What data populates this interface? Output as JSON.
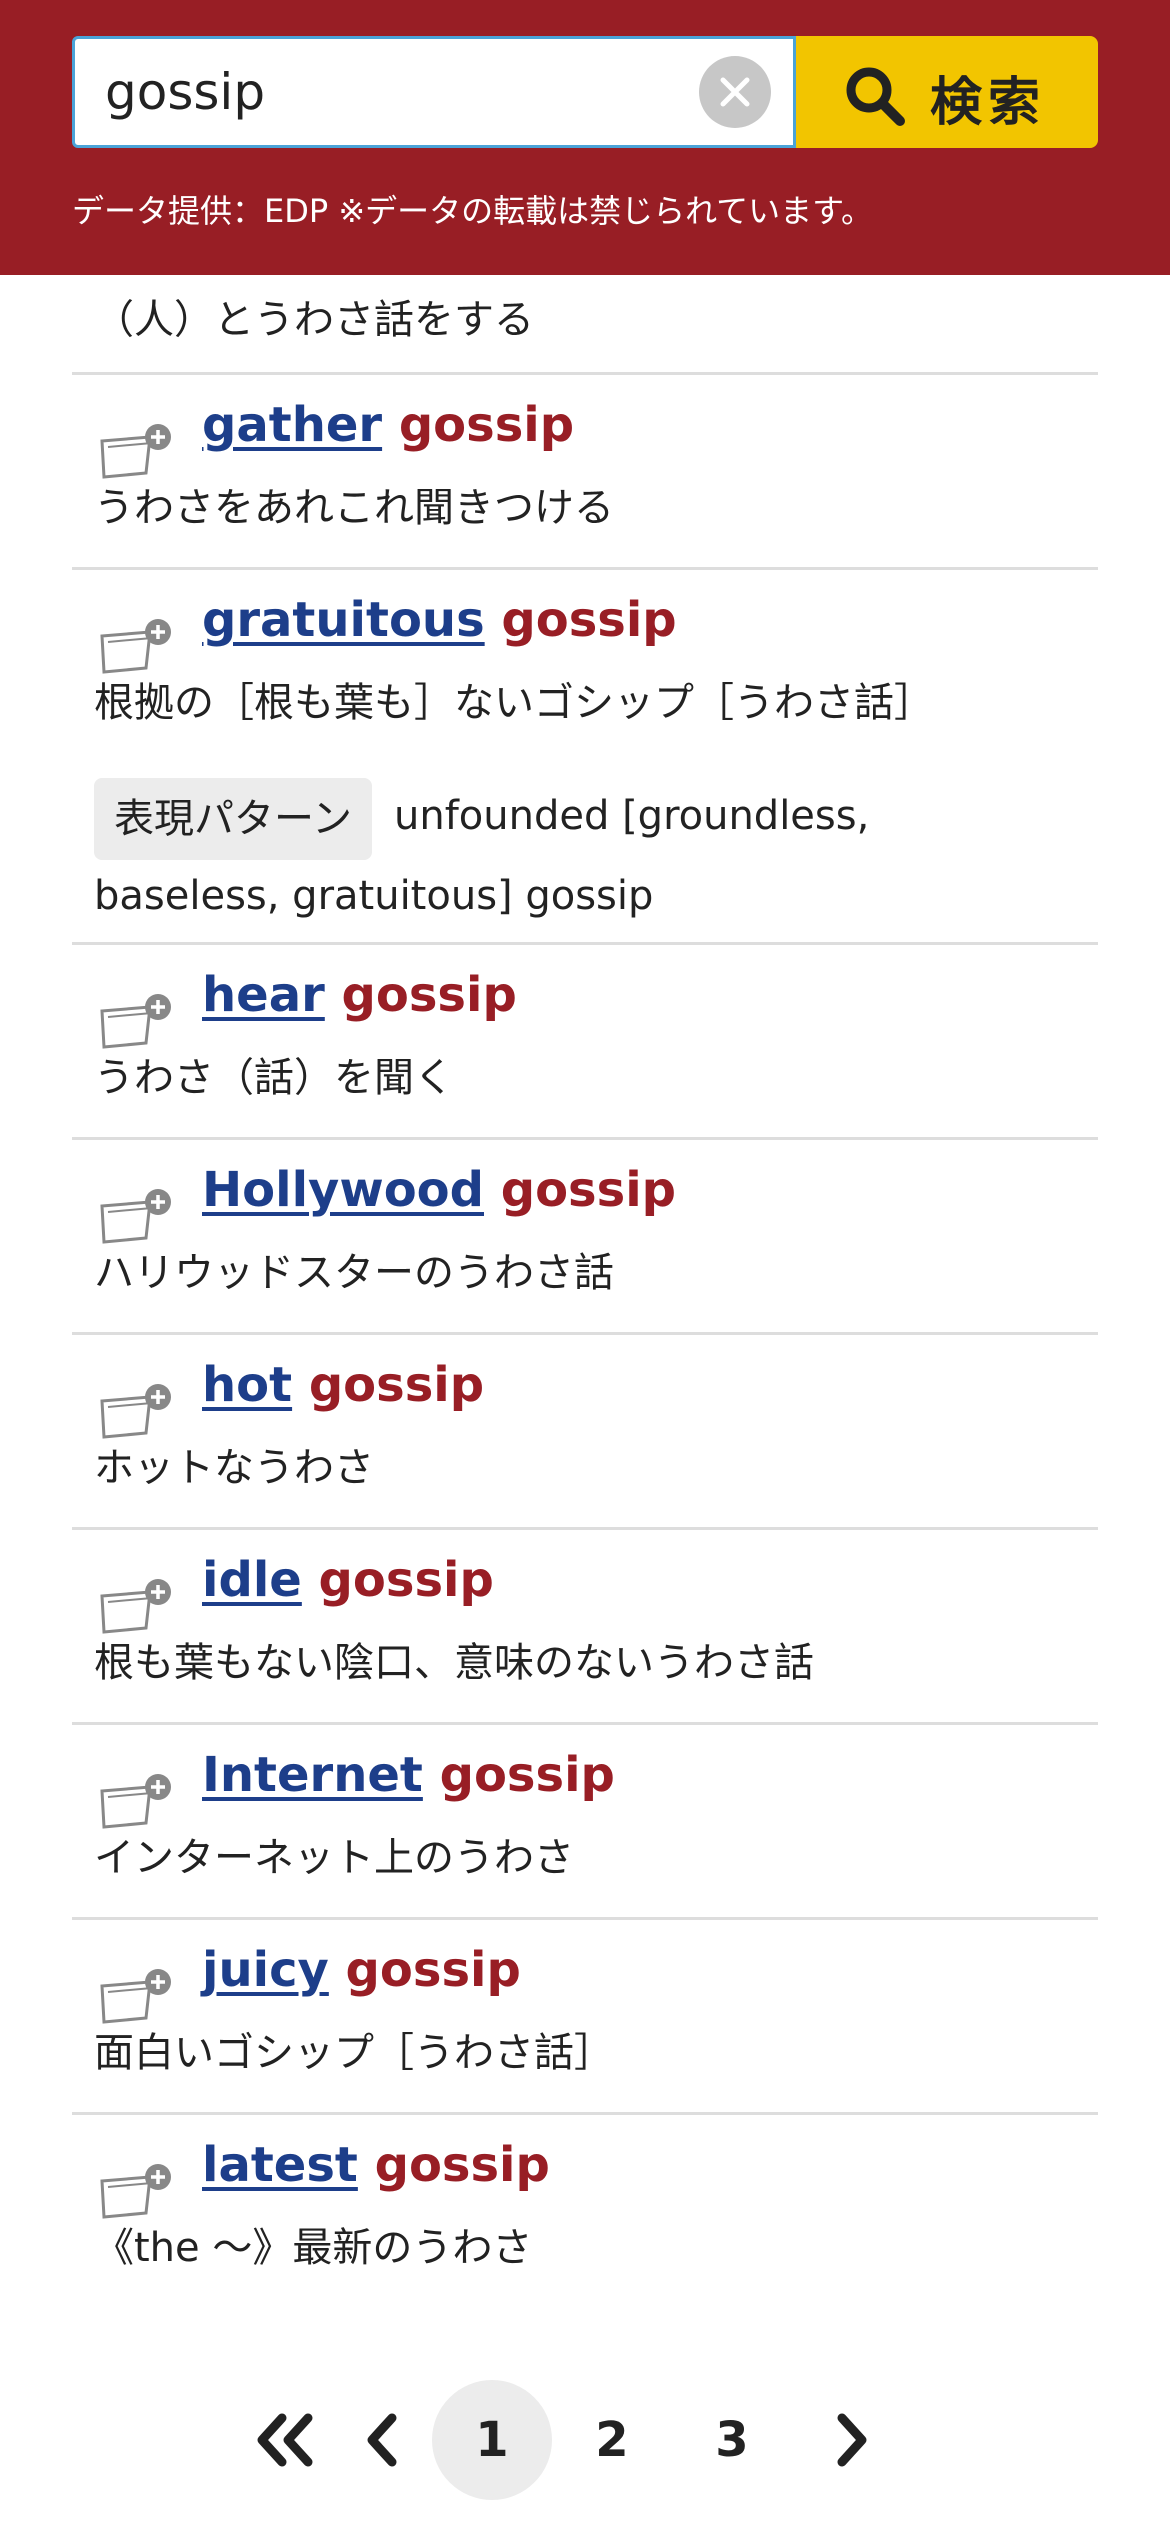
{
  "search": {
    "query": "gossip",
    "button_label": "検索"
  },
  "credit": "データ提供：EDP ※データの転載は禁じられています。",
  "partial_entry": {
    "meaning": "（人）とうわさ話をする"
  },
  "entries": [
    {
      "word": "gather",
      "key": "gossip",
      "meaning": "うわさをあれこれ聞きつける"
    },
    {
      "word": "gratuitous",
      "key": "gossip",
      "meaning": "根拠の［根も葉も］ないゴシップ［うわさ話］",
      "pattern_label": "表現パターン",
      "pattern_text": "unfounded [groundless, baseless, gratuitous] gossip"
    },
    {
      "word": "hear",
      "key": "gossip",
      "meaning": "うわさ（話）を聞く"
    },
    {
      "word": "Hollywood",
      "key": "gossip",
      "meaning": "ハリウッドスターのうわさ話"
    },
    {
      "word": "hot",
      "key": "gossip",
      "meaning": "ホットなうわさ"
    },
    {
      "word": "idle",
      "key": "gossip",
      "meaning": "根も葉もない陰口、意味のないうわさ話"
    },
    {
      "word": "Internet",
      "key": "gossip",
      "meaning": "インターネット上のうわさ"
    },
    {
      "word": "juicy",
      "key": "gossip",
      "meaning": "面白いゴシップ［うわさ話］"
    },
    {
      "word": "latest",
      "key": "gossip",
      "meaning": "《the ～》最新のうわさ"
    }
  ],
  "pagination": {
    "pages": [
      "1",
      "2",
      "3"
    ],
    "current": "1"
  },
  "icons": {
    "clear": "close-icon",
    "search": "magnifier-icon",
    "add": "add-to-wordbook-icon",
    "first": "double-chevron-left-icon",
    "prev": "chevron-left-icon",
    "next": "chevron-right-icon"
  },
  "colors": {
    "header_bg": "#981e25",
    "search_button": "#f2c500",
    "link": "#1d3e8a",
    "keyword": "#981e25"
  }
}
